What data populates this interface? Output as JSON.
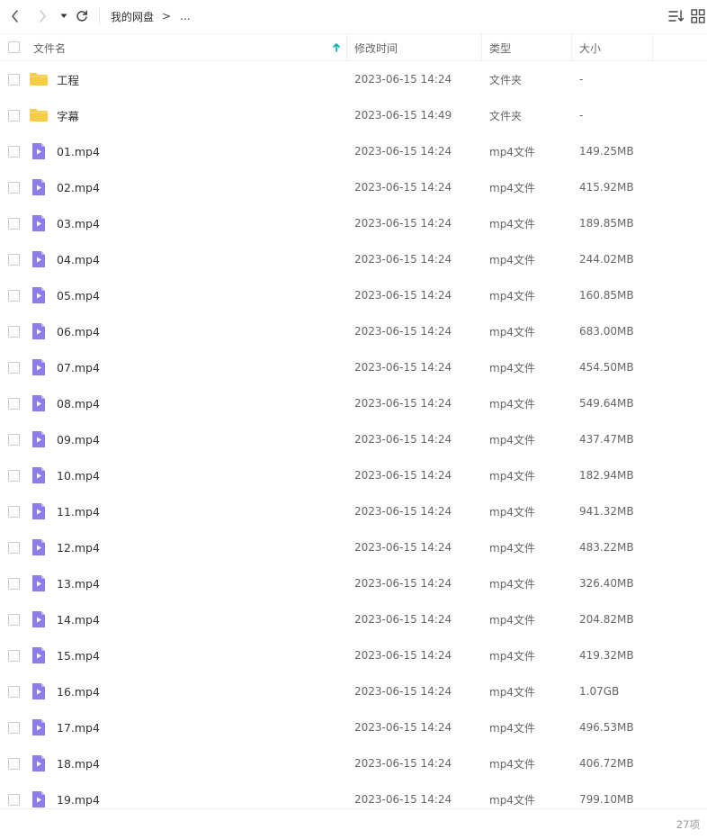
{
  "toolbar": {
    "breadcrumb": {
      "root": "我的网盘",
      "separator": ">",
      "ellipsis": "..."
    },
    "icons": [
      "back-icon",
      "forward-icon",
      "history-dropdown-icon",
      "refresh-icon",
      "sort-icon",
      "grid-view-icon"
    ]
  },
  "header": {
    "name": "文件名",
    "modified": "修改时间",
    "type": "类型",
    "size": "大小",
    "sort_indicator_color": "#06a7b4"
  },
  "colors": {
    "folder": "#f7cc4a",
    "video": "#8c7ee6"
  },
  "files": [
    {
      "name": "工程",
      "date": "2023-06-15 14:24",
      "type": "文件夹",
      "size": "-",
      "kind": "folder"
    },
    {
      "name": "字幕",
      "date": "2023-06-15 14:49",
      "type": "文件夹",
      "size": "-",
      "kind": "folder"
    },
    {
      "name": "01.mp4",
      "date": "2023-06-15 14:24",
      "type": "mp4文件",
      "size": "149.25MB",
      "kind": "video"
    },
    {
      "name": "02.mp4",
      "date": "2023-06-15 14:24",
      "type": "mp4文件",
      "size": "415.92MB",
      "kind": "video"
    },
    {
      "name": "03.mp4",
      "date": "2023-06-15 14:24",
      "type": "mp4文件",
      "size": "189.85MB",
      "kind": "video"
    },
    {
      "name": "04.mp4",
      "date": "2023-06-15 14:24",
      "type": "mp4文件",
      "size": "244.02MB",
      "kind": "video"
    },
    {
      "name": "05.mp4",
      "date": "2023-06-15 14:24",
      "type": "mp4文件",
      "size": "160.85MB",
      "kind": "video"
    },
    {
      "name": "06.mp4",
      "date": "2023-06-15 14:24",
      "type": "mp4文件",
      "size": "683.00MB",
      "kind": "video"
    },
    {
      "name": "07.mp4",
      "date": "2023-06-15 14:24",
      "type": "mp4文件",
      "size": "454.50MB",
      "kind": "video"
    },
    {
      "name": "08.mp4",
      "date": "2023-06-15 14:24",
      "type": "mp4文件",
      "size": "549.64MB",
      "kind": "video"
    },
    {
      "name": "09.mp4",
      "date": "2023-06-15 14:24",
      "type": "mp4文件",
      "size": "437.47MB",
      "kind": "video"
    },
    {
      "name": "10.mp4",
      "date": "2023-06-15 14:24",
      "type": "mp4文件",
      "size": "182.94MB",
      "kind": "video"
    },
    {
      "name": "11.mp4",
      "date": "2023-06-15 14:24",
      "type": "mp4文件",
      "size": "941.32MB",
      "kind": "video"
    },
    {
      "name": "12.mp4",
      "date": "2023-06-15 14:24",
      "type": "mp4文件",
      "size": "483.22MB",
      "kind": "video"
    },
    {
      "name": "13.mp4",
      "date": "2023-06-15 14:24",
      "type": "mp4文件",
      "size": "326.40MB",
      "kind": "video"
    },
    {
      "name": "14.mp4",
      "date": "2023-06-15 14:24",
      "type": "mp4文件",
      "size": "204.82MB",
      "kind": "video"
    },
    {
      "name": "15.mp4",
      "date": "2023-06-15 14:24",
      "type": "mp4文件",
      "size": "419.32MB",
      "kind": "video"
    },
    {
      "name": "16.mp4",
      "date": "2023-06-15 14:24",
      "type": "mp4文件",
      "size": "1.07GB",
      "kind": "video"
    },
    {
      "name": "17.mp4",
      "date": "2023-06-15 14:24",
      "type": "mp4文件",
      "size": "496.53MB",
      "kind": "video"
    },
    {
      "name": "18.mp4",
      "date": "2023-06-15 14:24",
      "type": "mp4文件",
      "size": "406.72MB",
      "kind": "video"
    },
    {
      "name": "19.mp4",
      "date": "2023-06-15 14:24",
      "type": "mp4文件",
      "size": "799.10MB",
      "kind": "video"
    }
  ],
  "footer": {
    "count": "27项"
  }
}
